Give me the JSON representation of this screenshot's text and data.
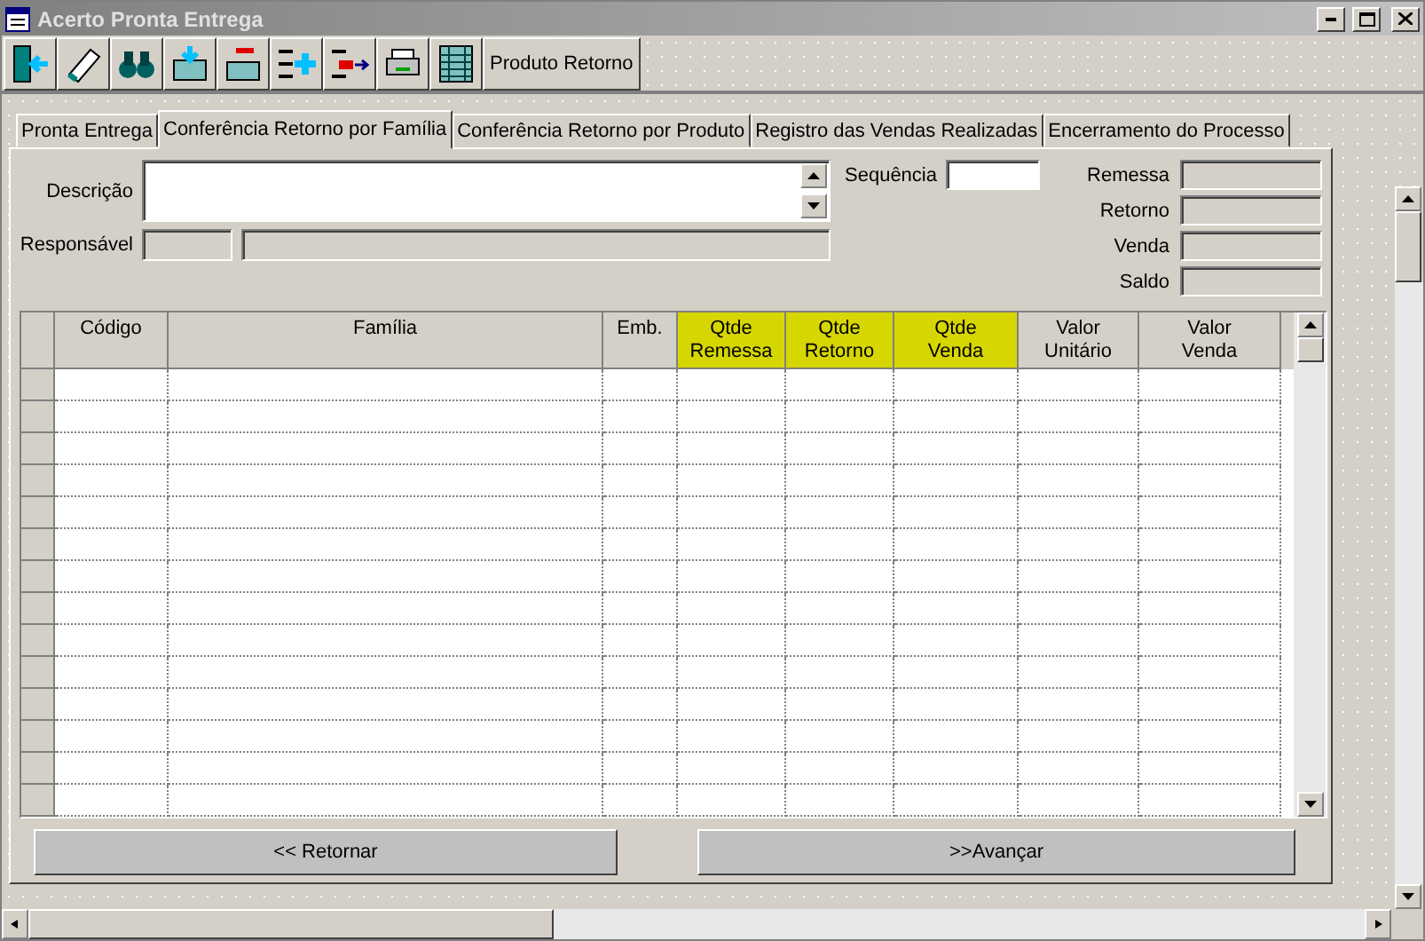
{
  "window": {
    "title": "Acerto Pronta Entrega"
  },
  "toolbar": {
    "buttons": [
      {
        "kind": "exit"
      },
      {
        "kind": "erase"
      },
      {
        "kind": "find"
      },
      {
        "kind": "open"
      },
      {
        "kind": "remove"
      },
      {
        "kind": "add"
      },
      {
        "kind": "export"
      },
      {
        "kind": "print"
      },
      {
        "kind": "grid"
      }
    ],
    "text_button": "Produto Retorno"
  },
  "tabs": [
    {
      "label": "Pronta Entrega",
      "selected": false
    },
    {
      "label": "Conferência Retorno por Família",
      "selected": true
    },
    {
      "label": "Conferência Retorno por Produto",
      "selected": false
    },
    {
      "label": "Registro das Vendas Realizadas",
      "selected": false
    },
    {
      "label": "Encerramento do Processo",
      "selected": false
    }
  ],
  "form": {
    "descricao_label": "Descrição",
    "responsavel_label": "Responsável",
    "sequencia_label": "Sequência",
    "totals": [
      {
        "label": "Remessa"
      },
      {
        "label": "Retorno"
      },
      {
        "label": "Venda"
      },
      {
        "label": "Saldo"
      }
    ]
  },
  "table": {
    "columns": [
      {
        "bottom": "Código",
        "highlight": false
      },
      {
        "bottom": "Família",
        "highlight": false
      },
      {
        "bottom": "Emb.",
        "highlight": false
      },
      {
        "top": "Qtde",
        "bottom": "Remessa",
        "highlight": true
      },
      {
        "top": "Qtde",
        "bottom": "Retorno",
        "highlight": true
      },
      {
        "top": "Qtde",
        "bottom": "Venda",
        "highlight": true
      },
      {
        "top": "Valor",
        "bottom": "Unitário",
        "highlight": false
      },
      {
        "top": "Valor",
        "bottom": "Venda",
        "highlight": false
      }
    ]
  },
  "buttons": [
    {
      "label": "<< Retornar"
    },
    {
      "label": ">>Avançar"
    }
  ]
}
